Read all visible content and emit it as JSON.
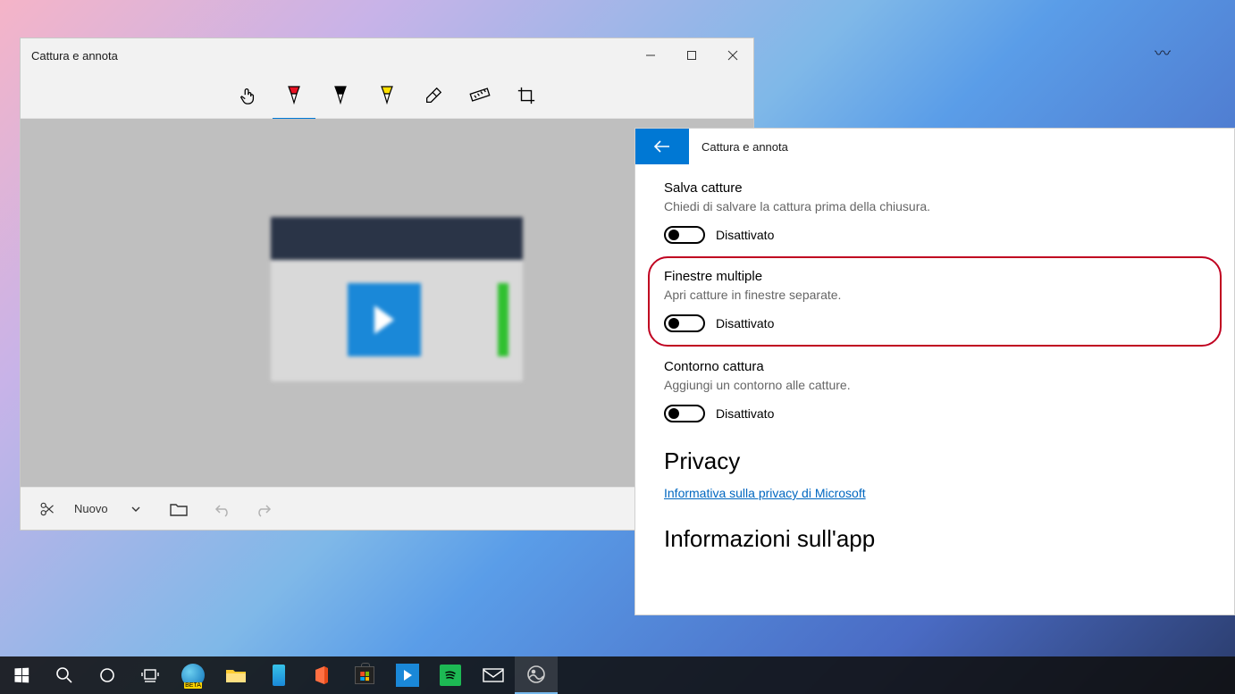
{
  "snip": {
    "title": "Cattura e annota",
    "new_button": "Nuovo",
    "tools": {
      "touch": "touch-writing-icon",
      "ballpoint": "ballpoint-pen-icon",
      "pencil": "pencil-icon",
      "highlighter": "highlighter-icon",
      "eraser": "eraser-icon",
      "ruler": "ruler-icon",
      "crop": "crop-icon"
    }
  },
  "settings": {
    "title": "Cattura e annota",
    "save": {
      "title": "Salva catture",
      "desc": "Chiedi di salvare la cattura prima della chiusura.",
      "state": "Disattivato"
    },
    "multi": {
      "title": "Finestre multiple",
      "desc": "Apri catture in finestre separate.",
      "state": "Disattivato"
    },
    "outline": {
      "title": "Contorno cattura",
      "desc": "Aggiungi un contorno alle catture.",
      "state": "Disattivato"
    },
    "privacy_head": "Privacy",
    "privacy_link": "Informativa sulla privacy di Microsoft",
    "about_head": "Informazioni sull'app"
  },
  "taskbar": {
    "items": [
      "start",
      "search",
      "cortana",
      "task-view",
      "edge-beta",
      "file-explorer",
      "phone",
      "office",
      "store",
      "snip",
      "spotify",
      "mail",
      "photos"
    ]
  }
}
